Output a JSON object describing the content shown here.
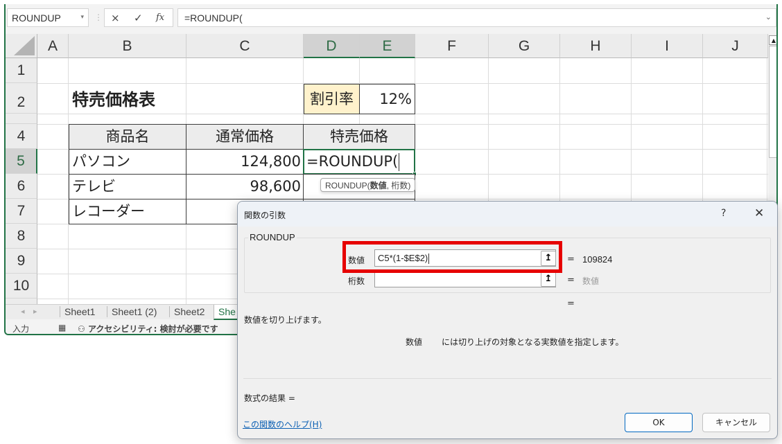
{
  "formula_bar": {
    "name_box": "ROUNDUP",
    "cancel_icon": "×",
    "enter_icon": "✓",
    "fx_label": "fx",
    "formula": "=ROUNDUP("
  },
  "columns": [
    "A",
    "B",
    "C",
    "D",
    "E",
    "F",
    "G",
    "H",
    "I",
    "J"
  ],
  "rows": [
    "1",
    "2",
    "",
    "4",
    "5",
    "6",
    "7",
    "8",
    "9",
    "10"
  ],
  "sheet": {
    "title": "特売価格表",
    "discount_label": "割引率",
    "discount_value": "12%",
    "table_headers": [
      "商品名",
      "通常価格",
      "特売価格"
    ],
    "products": [
      {
        "name": "パソコン",
        "price": "124,800",
        "sale": "=ROUNDUP("
      },
      {
        "name": "テレビ",
        "price": "98,600",
        "sale": ""
      },
      {
        "name": "レコーダー",
        "price": "",
        "sale": ""
      }
    ],
    "tooltip_fn": "ROUNDUP(",
    "tooltip_arg1": "数値",
    "tooltip_rest": ", 桁数)"
  },
  "tabs": {
    "items": [
      "Sheet1",
      "Sheet1 (2)",
      "Sheet2",
      "She"
    ]
  },
  "status": {
    "mode": "入力",
    "accessibility": "アクセシビリティ: 検討が必要です"
  },
  "dialog": {
    "title": "関数の引数",
    "help_icon": "?",
    "close_icon": "✕",
    "function_name": "ROUNDUP",
    "args": [
      {
        "label": "数値",
        "value": "C5*(1-$E$2)",
        "result": "109824"
      },
      {
        "label": "桁数",
        "value": "",
        "result": "数値"
      }
    ],
    "extra_eq": "=",
    "description": "数値を切り上げます。",
    "arg_desc_name": "数値",
    "arg_desc_text": "には切り上げの対象となる実数値を指定します。",
    "formula_result_label": "数式の結果 =",
    "help_link": "この関数のヘルプ(H)",
    "ok_label": "OK",
    "cancel_label": "キャンセル",
    "highlight_color": "#e60000"
  }
}
